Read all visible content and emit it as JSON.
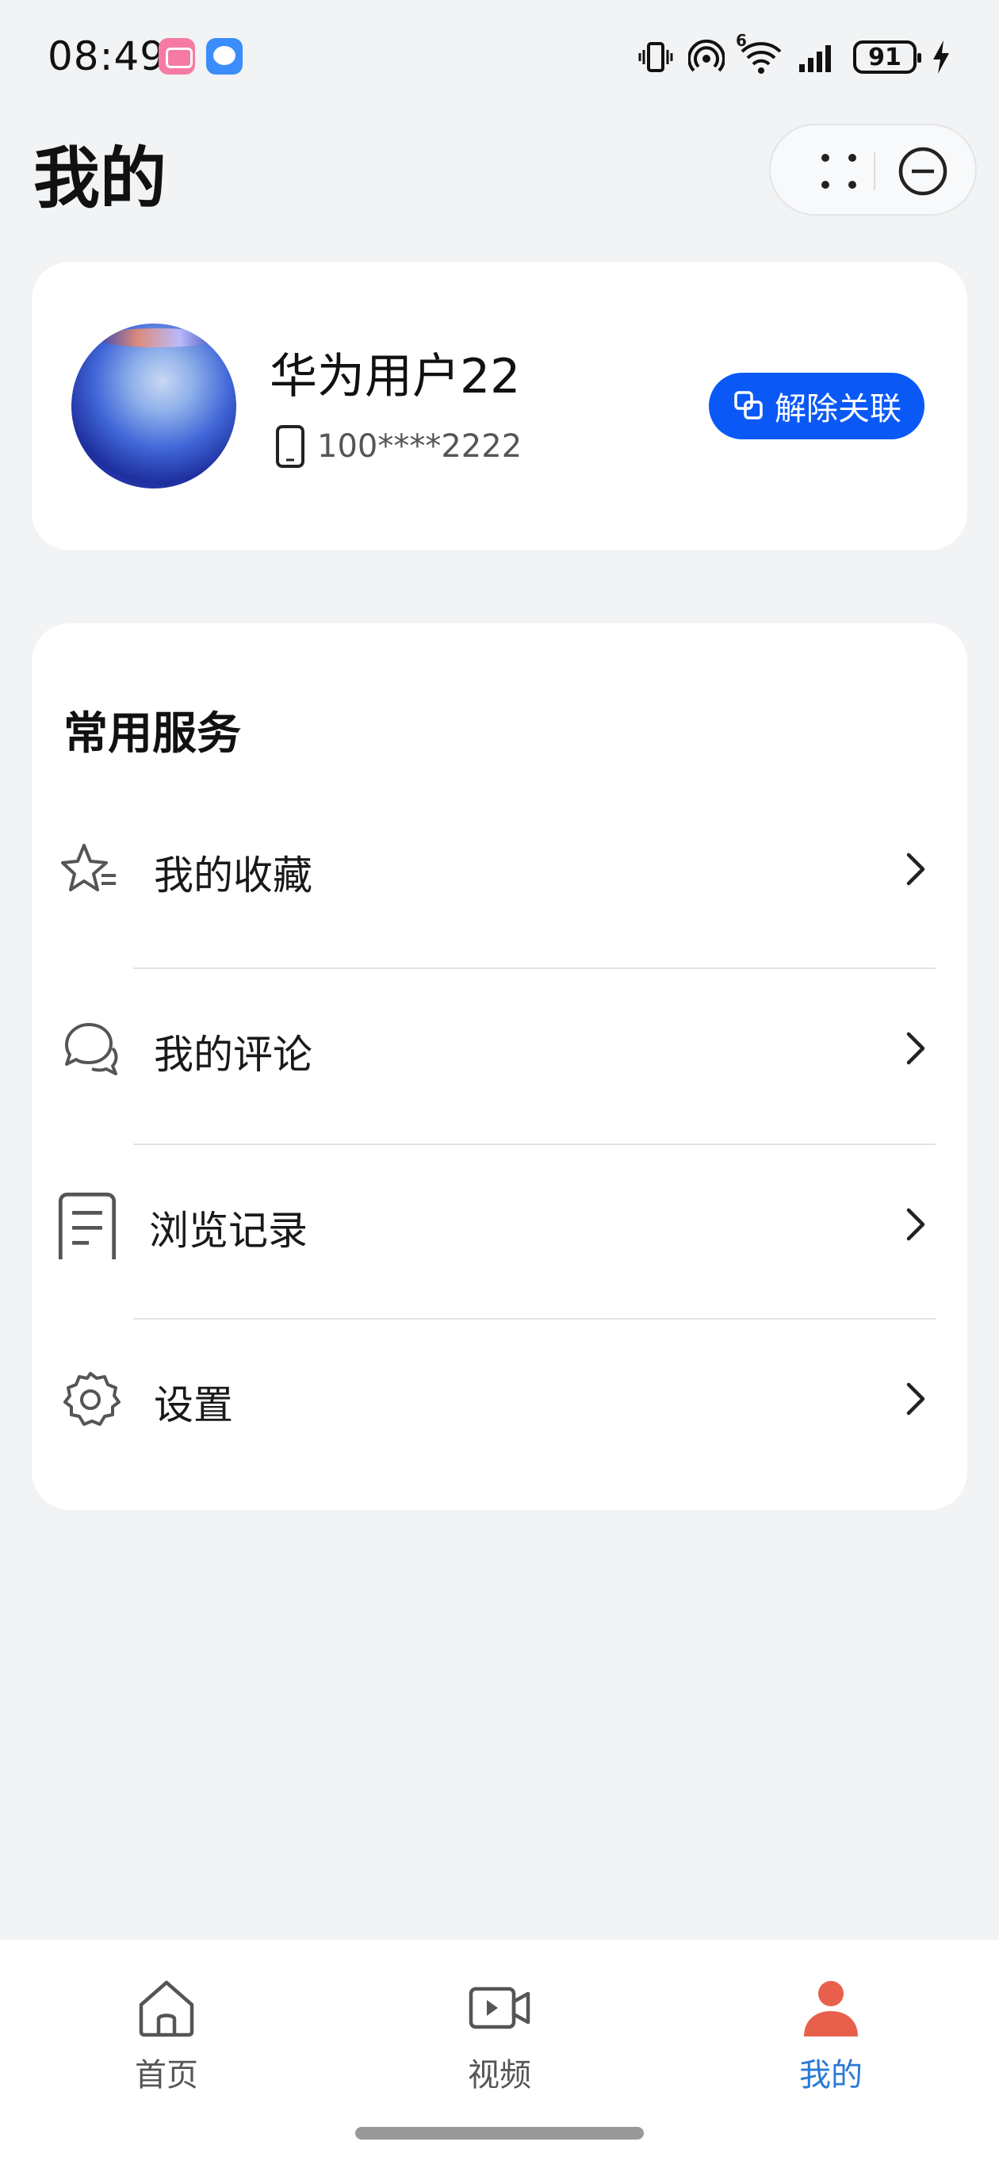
{
  "status_bar": {
    "time": "08:49",
    "app_icons": [
      "bilibili-icon",
      "message-icon"
    ],
    "network": "6",
    "battery": "91"
  },
  "header": {
    "title": "我的"
  },
  "profile": {
    "name": "华为用户22",
    "phone": "100****2222",
    "unlink_label": "解除关联"
  },
  "services": {
    "title": "常用服务",
    "items": [
      {
        "label": "我的收藏",
        "icon": "star-list-icon"
      },
      {
        "label": "我的评论",
        "icon": "comment-icon"
      },
      {
        "label": "浏览记录",
        "icon": "document-icon"
      },
      {
        "label": "设置",
        "icon": "gear-icon"
      }
    ]
  },
  "bottom_nav": {
    "items": [
      {
        "label": "首页",
        "icon": "home-icon",
        "active": false
      },
      {
        "label": "视频",
        "icon": "video-icon",
        "active": false
      },
      {
        "label": "我的",
        "icon": "person-icon",
        "active": true
      }
    ]
  },
  "colors": {
    "accent": "#0a59f7",
    "active_tab": "#2a7ad6",
    "active_tab_icon": "#e8604c",
    "background": "#f1f3f5"
  }
}
